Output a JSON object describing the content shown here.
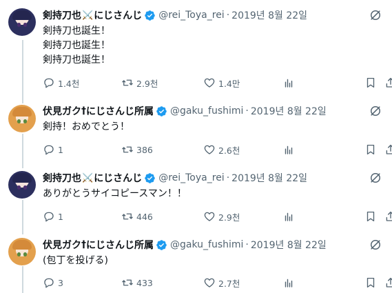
{
  "tweets": [
    {
      "name": "剣持刀也",
      "name_suffix": "にじさんじ",
      "emoji": "⚔️",
      "handle": "@rei_Toya_rei",
      "dot": "·",
      "date": "2019년 8월 22일",
      "text": "剣持刀也誕生！\n剣持刀也誕生！\n剣持刀也誕生！",
      "replies": "1.4천",
      "retweets": "2.9천",
      "likes": "1.4만",
      "avatar": "rei"
    },
    {
      "name": "伏見ガク",
      "name_suffix": "にじさんじ所属",
      "emoji": "†",
      "handle": "@gaku_fushimi",
      "dot": "·",
      "date": "2019년 8월 22일",
      "text": "剣持！おめでとう！",
      "replies": "1",
      "retweets": "386",
      "likes": "2.6천",
      "avatar": "gaku"
    },
    {
      "name": "剣持刀也",
      "name_suffix": "にじさんじ",
      "emoji": "⚔️",
      "handle": "@rei_Toya_rei",
      "dot": "·",
      "date": "2019년 8월 22일",
      "text": "ありがとうサイコピースマン！！",
      "replies": "1",
      "retweets": "446",
      "likes": "2.9천",
      "avatar": "rei"
    },
    {
      "name": "伏見ガク",
      "name_suffix": "にじさんじ所属",
      "emoji": "†",
      "handle": "@gaku_fushimi",
      "dot": "·",
      "date": "2019년 8월 22일",
      "text": "(包丁を投げる)",
      "replies": "3",
      "retweets": "433",
      "likes": "2.7천",
      "avatar": "gaku"
    }
  ],
  "colors": {
    "verified": "#1d9bf0",
    "secondary_text": "#536471",
    "thread_line": "#cfd9de"
  }
}
